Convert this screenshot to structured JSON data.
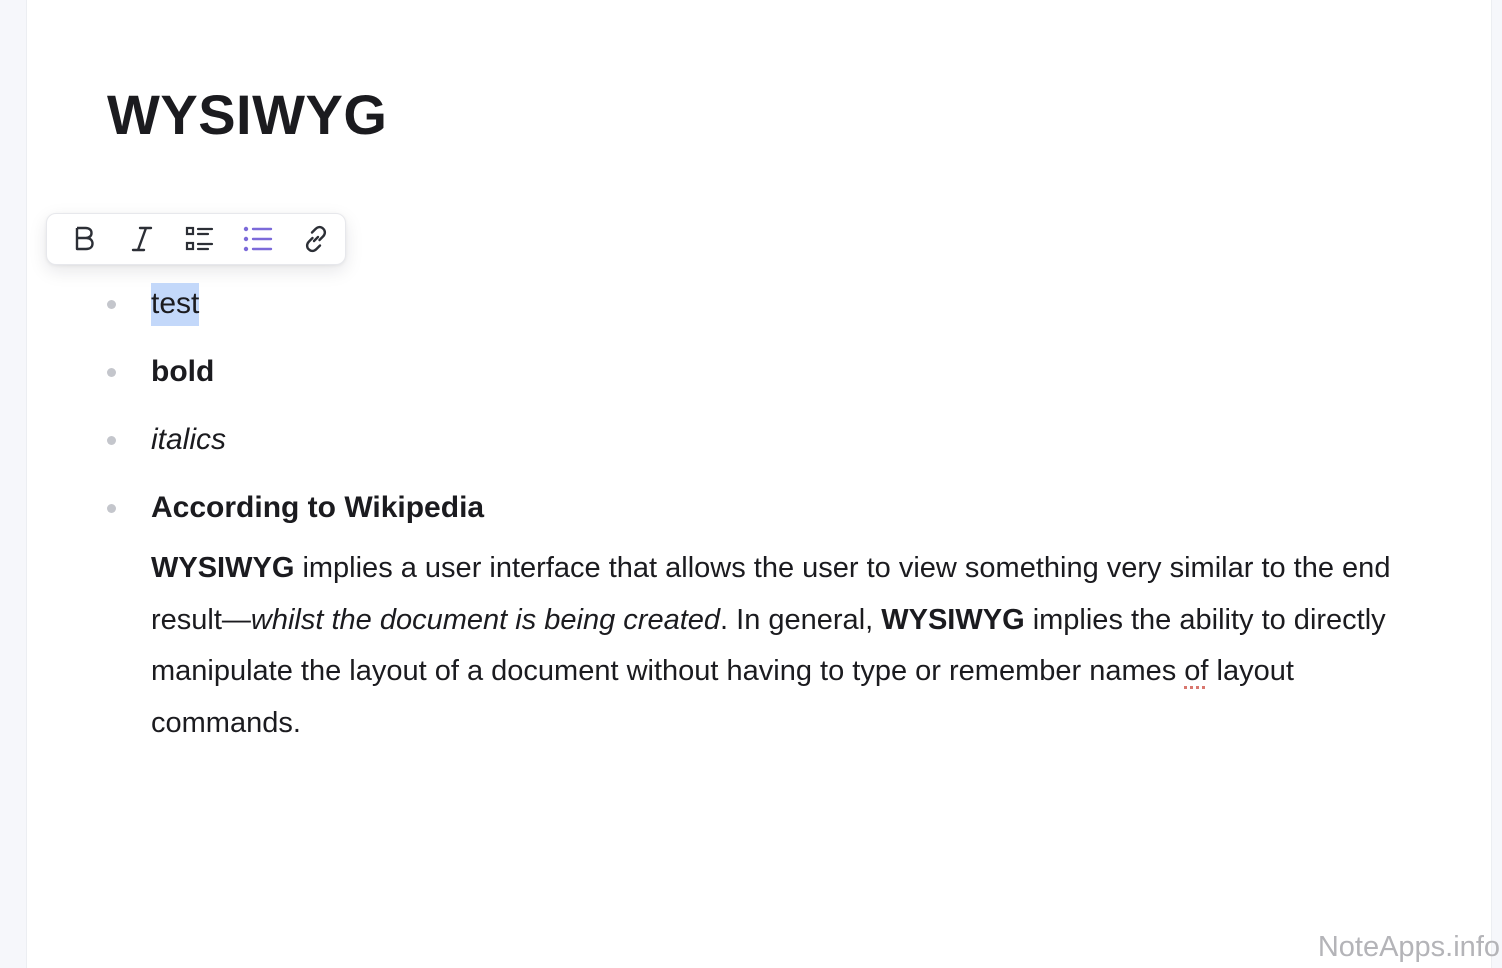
{
  "document": {
    "title": "WYSIWYG"
  },
  "toolbar": {
    "buttons": [
      {
        "icon": "bold-icon",
        "state": "default"
      },
      {
        "icon": "italic-icon",
        "state": "default"
      },
      {
        "icon": "checklist-icon",
        "state": "default"
      },
      {
        "icon": "bullet-list-icon",
        "state": "active"
      },
      {
        "icon": "link-icon",
        "state": "default"
      }
    ],
    "active_color": "#7c6ad9",
    "default_color": "#2c2f36"
  },
  "list": {
    "items": [
      {
        "text": "test",
        "style": "selected"
      },
      {
        "text": "bold",
        "style": "bold"
      },
      {
        "text": "italics",
        "style": "italic"
      },
      {
        "text": "According to Wikipedia",
        "style": "bold"
      }
    ]
  },
  "paragraph": {
    "p1_bold": "WYSIWYG",
    "p2": " implies a user interface that allows the user to view something very similar to the end result—",
    "p3_italic": "whilst the document is being created",
    "p4": ". In general, ",
    "p5_bold": "WYSIWYG",
    "p6": " implies the ability to directly manipulate the layout of a document without having to type or remember names ",
    "p7_spell": "of",
    "p8": " layout commands."
  },
  "colors": {
    "selection": "#c3d8fa",
    "spellcheck": "#d9776f"
  },
  "watermark": "NoteApps.info"
}
